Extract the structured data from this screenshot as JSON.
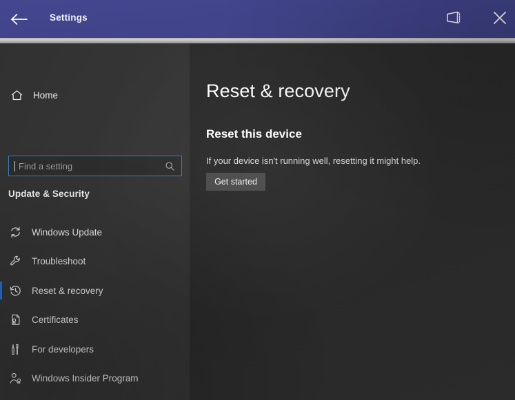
{
  "window": {
    "title": "Settings",
    "titlebar_color": "#42458c",
    "back_icon": "back-arrow-icon",
    "tablet_icon": "tablet-mode-icon",
    "close_icon": "close-icon"
  },
  "sidebar": {
    "background_color": "#333333",
    "home": {
      "label": "Home",
      "icon": "home-icon"
    },
    "search": {
      "value": "",
      "placeholder": "Find a setting",
      "icon": "search-icon",
      "focus_border_color": "#3a7ebf"
    },
    "group_header": "Update & Security",
    "selection_accent_color": "#2a6fc9",
    "items": [
      {
        "label": "Windows Update",
        "icon": "sync-icon",
        "selected": false
      },
      {
        "label": "Troubleshoot",
        "icon": "wrench-icon",
        "selected": false
      },
      {
        "label": "Reset & recovery",
        "icon": "history-clock-icon",
        "selected": true
      },
      {
        "label": "Certificates",
        "icon": "certificate-document-icon",
        "selected": false
      },
      {
        "label": "For developers",
        "icon": "developer-tools-icon",
        "selected": false
      },
      {
        "label": "Windows Insider Program",
        "icon": "person-badge-icon",
        "selected": false
      }
    ]
  },
  "main": {
    "page_title": "Reset & recovery",
    "section_title": "Reset this device",
    "section_description": "If your device isn't running well, resetting it might help.",
    "get_started_label": "Get started",
    "button_color": "#4b4b4b"
  }
}
